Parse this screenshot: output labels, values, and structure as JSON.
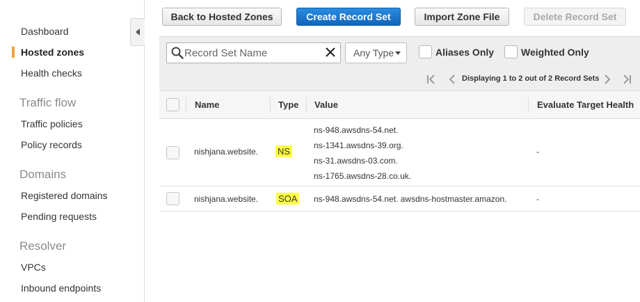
{
  "sidebar": {
    "items": [
      {
        "label": "Dashboard"
      },
      {
        "label": "Hosted zones"
      },
      {
        "label": "Health checks"
      },
      {
        "label": "Traffic policies"
      },
      {
        "label": "Policy records"
      },
      {
        "label": "Registered domains"
      },
      {
        "label": "Pending requests"
      },
      {
        "label": "VPCs"
      },
      {
        "label": "Inbound endpoints"
      }
    ],
    "sections": [
      {
        "label": "Traffic flow"
      },
      {
        "label": "Domains"
      },
      {
        "label": "Resolver"
      }
    ],
    "active_item": "Hosted zones",
    "accent_color": "#f0a040"
  },
  "toolbar": {
    "back_label": "Back to Hosted Zones",
    "create_label": "Create Record Set",
    "import_label": "Import Zone File",
    "delete_label": "Delete Record Set"
  },
  "filter": {
    "search_placeholder": "Record Set Name",
    "search_value": "",
    "type_selected": "Any Type",
    "aliases_label": "Aliases Only",
    "weighted_label": "Weighted Only"
  },
  "pagination": {
    "text": "Displaying 1 to 2 out of 2 Record Sets"
  },
  "table": {
    "columns": {
      "name": "Name",
      "type": "Type",
      "value": "Value",
      "evaluate": "Evaluate Target Health"
    },
    "rows": [
      {
        "name": "nishjana.website.",
        "type": "NS",
        "values": [
          "ns-948.awsdns-54.net.",
          "ns-1341.awsdns-39.org.",
          "ns-31.awsdns-03.com.",
          "ns-1765.awsdns-28.co.uk."
        ],
        "evaluate": "-"
      },
      {
        "name": "nishjana.website.",
        "type": "SOA",
        "values": [
          "ns-948.awsdns-54.net. awsdns-hostmaster.amazon."
        ],
        "evaluate": "-"
      }
    ]
  },
  "colors": {
    "primary_button": "#1a73cc",
    "highlight": "#ffff44"
  }
}
